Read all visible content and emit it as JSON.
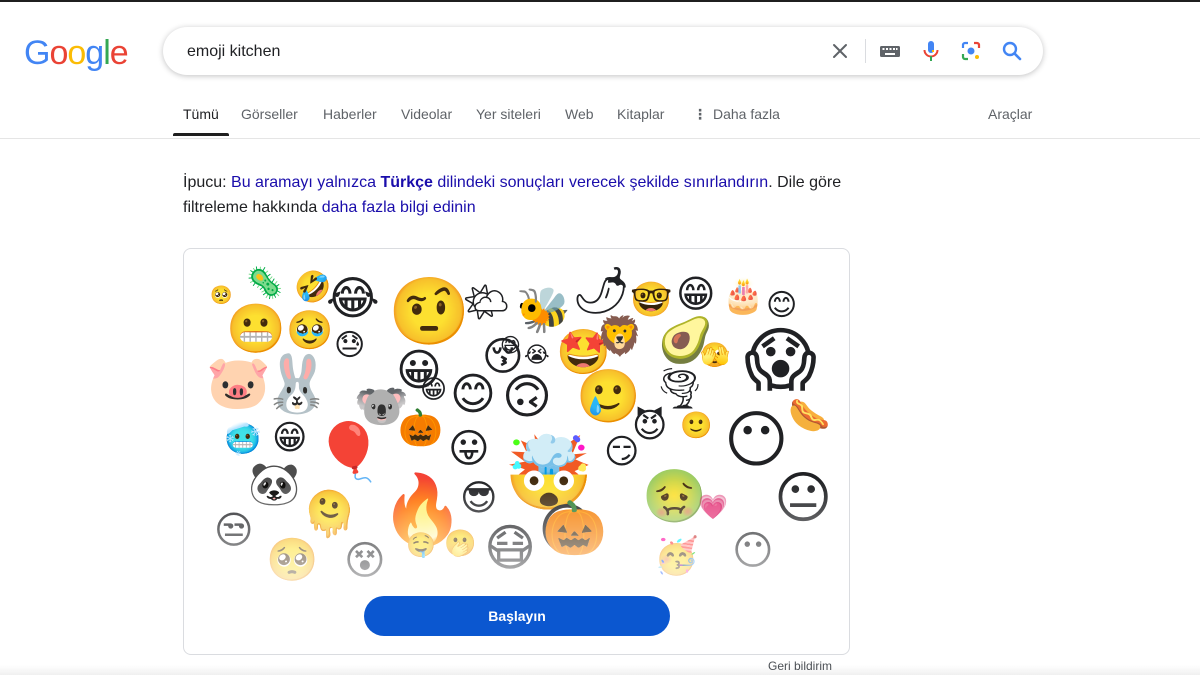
{
  "logo": {
    "letters": [
      "G",
      "o",
      "o",
      "g",
      "l",
      "e"
    ],
    "colors": [
      "#4285F4",
      "#EA4335",
      "#FBBC05",
      "#4285F4",
      "#34A853",
      "#EA4335"
    ]
  },
  "search": {
    "query": "emoji kitchen"
  },
  "icons": {
    "clear": "close-icon",
    "keyboard": "keyboard-icon",
    "voice": "microphone-icon",
    "lens": "camera-lens-icon",
    "search": "search-icon"
  },
  "tabs": {
    "all": "Tümü",
    "images": "Görseller",
    "news": "Haberler",
    "videos": "Videolar",
    "places": "Yer siteleri",
    "web": "Web",
    "books": "Kitaplar",
    "more": "Daha fazla",
    "tools": "Araçlar"
  },
  "tip": {
    "prefix": "İpucu: ",
    "link1_a": "Bu aramayı yalnızca ",
    "link1_lang": "Türkçe",
    "link1_b": " dilindeki sonuçları verecek şekilde sınırlandırın",
    "middle": ". Dile göre filtreleme hakkında ",
    "link2": "daha fazla bilgi edinin"
  },
  "card": {
    "emojis": [
      "🥺",
      "🦠",
      "🤣",
      "😂",
      "🤨",
      "🌤",
      "🐝",
      "🌶",
      "🤓",
      "😁",
      "🎂",
      "😊",
      "😬",
      "🥹",
      "😓",
      "😀",
      "😚",
      "😄",
      "😭",
      "🤩",
      "🦁",
      "🥑",
      "🫣",
      "😱",
      "🐷",
      "🐰",
      "🐨",
      "😁",
      "😊",
      "🙃",
      "🥲",
      "🌪",
      "😶",
      "🌭",
      "🥶",
      "😁",
      "🎈",
      "🎃",
      "😛",
      "🤯",
      "😏",
      "🙂",
      "😈",
      "🐼",
      "🫠",
      "🔥",
      "😎",
      "😋",
      "🤢",
      "💗",
      "😐",
      "😒",
      "🥺",
      "😵",
      "🤤",
      "🫢",
      "😷",
      "🎃",
      "🥳",
      "😶"
    ],
    "cta": "Başlayın"
  },
  "feedback": "Geri bildirim"
}
